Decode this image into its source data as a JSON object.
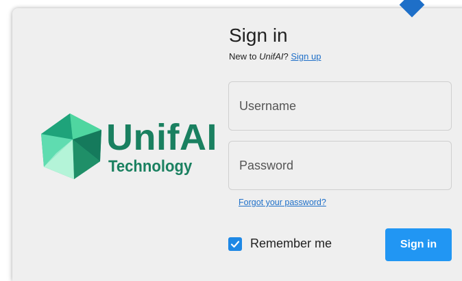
{
  "brand": {
    "name": "UnifAI",
    "tagline": "Technology",
    "color": "#1a8060",
    "logo_icon": "faceted-gem-icon"
  },
  "form": {
    "title": "Sign in",
    "subtitle_prefix": "New to ",
    "subtitle_brand": "UnifAI",
    "subtitle_suffix": "? ",
    "signup_link": "Sign up",
    "username_placeholder": "Username",
    "password_placeholder": "Password",
    "forgot_link": "Forgot your password?",
    "remember_label": "Remember me",
    "remember_checked": true,
    "submit_label": "Sign in"
  },
  "colors": {
    "accent": "#2196f3",
    "link": "#1e6fc8",
    "card_bg": "#efefef"
  }
}
